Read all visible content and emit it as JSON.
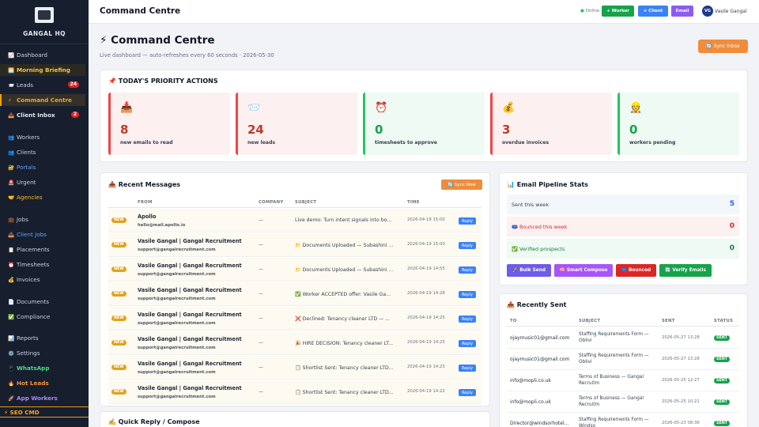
{
  "sidebar": {
    "brand": "GANGAL HQ",
    "items": [
      {
        "icon": "📈",
        "label": "Dashboard"
      },
      {
        "icon": "🌅",
        "label": "Morning Briefing"
      },
      {
        "icon": "📨",
        "label": "Leads",
        "badge": "24"
      },
      {
        "icon": "⚡",
        "label": "Command Centre"
      },
      {
        "icon": "📥",
        "label": "Client Inbox",
        "badge": "2"
      },
      {
        "icon": "👥",
        "label": "Workers"
      },
      {
        "icon": "👥",
        "label": "Clients"
      },
      {
        "icon": "🔐",
        "label": "Portals"
      },
      {
        "icon": "🚨",
        "label": "Urgent"
      },
      {
        "icon": "🤝",
        "label": "Agencies"
      },
      {
        "icon": "💼",
        "label": "Jobs"
      },
      {
        "icon": "📥",
        "label": "Client Jobs"
      },
      {
        "icon": "📋",
        "label": "Placements"
      },
      {
        "icon": "⏰",
        "label": "Timesheets"
      },
      {
        "icon": "💰",
        "label": "Invoices"
      },
      {
        "icon": "📄",
        "label": "Documents"
      },
      {
        "icon": "✅",
        "label": "Compliance"
      },
      {
        "icon": "📊",
        "label": "Reports"
      },
      {
        "icon": "⚙️",
        "label": "Settings"
      },
      {
        "icon": "📱",
        "label": "WhatsApp"
      },
      {
        "icon": "🔥",
        "label": "Hot Leads"
      },
      {
        "icon": "🚀",
        "label": "App Workers"
      }
    ],
    "seo": "⚡ SEO CMD"
  },
  "topbar": {
    "title": "Command Centre",
    "status": "Online",
    "buttons": [
      "+ Worker",
      "+ Client",
      "Email"
    ],
    "user_initials": "VG",
    "user_name": "Vasile Gangal"
  },
  "header": {
    "title": "⚡ Command Centre",
    "subtitle": "Live dashboard — auto-refreshes every 60 seconds · 2026-05-30",
    "sync_button": "🔄 Sync Inbox"
  },
  "priority": {
    "title": "📌 TODAY'S PRIORITY ACTIONS",
    "cards": [
      {
        "icon": "📥",
        "value": "8",
        "label": "new emails to read"
      },
      {
        "icon": "📨",
        "value": "24",
        "label": "new leads"
      },
      {
        "icon": "⏰",
        "value": "0",
        "label": "timesheets to approve"
      },
      {
        "icon": "💰",
        "value": "3",
        "label": "overdue invoices"
      },
      {
        "icon": "👷",
        "value": "0",
        "label": "workers pending"
      }
    ]
  },
  "messages": {
    "title": "📥 Recent Messages",
    "sync_button": "🔄 Sync Now",
    "columns": [
      "FROM",
      "COMPANY",
      "SUBJECT",
      "TIME"
    ],
    "badge": "NEW",
    "reply_label": "Reply",
    "rows": [
      {
        "name": "Apollo",
        "email": "hello@mail.apollo.io",
        "company": "—",
        "subject": "Live demo: Turn intent signals into bo...",
        "time": "2026-04-19 15:00"
      },
      {
        "name": "Vasile Gangal | Gangal Recruitment",
        "email": "support@gangalrecruitment.com",
        "company": "—",
        "subject": "📁 Documents Uploaded — Subashini ...",
        "time": "2026-04-19 15:00"
      },
      {
        "name": "Vasile Gangal | Gangal Recruitment",
        "email": "support@gangalrecruitment.com",
        "company": "—",
        "subject": "📁 Documents Uploaded — Subashini ...",
        "time": "2026-04-19 14:55"
      },
      {
        "name": "Vasile Gangal | Gangal Recruitment",
        "email": "support@gangalrecruitment.com",
        "company": "—",
        "subject": "✅ Worker ACCEPTED offer: Vasile Ga...",
        "time": "2026-04-19 14:28"
      },
      {
        "name": "Vasile Gangal | Gangal Recruitment",
        "email": "support@gangalrecruitment.com",
        "company": "—",
        "subject": "❌ Declined: Tenancy cleaner LTD — ...",
        "time": "2026-04-19 14:25"
      },
      {
        "name": "Vasile Gangal | Gangal Recruitment",
        "email": "support@gangalrecruitment.com",
        "company": "—",
        "subject": "🎉 HIRE DECISION: Tenancy cleaner LT...",
        "time": "2026-04-19 14:25"
      },
      {
        "name": "Vasile Gangal | Gangal Recruitment",
        "email": "support@gangalrecruitment.com",
        "company": "—",
        "subject": "📋 Shortlist Sent: Tenancy cleaner LTD...",
        "time": "2026-04-19 14:23"
      },
      {
        "name": "Vasile Gangal | Gangal Recruitment",
        "email": "support@gangalrecruitment.com",
        "company": "—",
        "subject": "📋 Shortlist Sent: Tenancy cleaner LTD...",
        "time": "2026-04-19 14:22"
      }
    ]
  },
  "quick_reply": {
    "title": "✍️ Quick Reply / Compose"
  },
  "pipeline": {
    "title": "📊 Email Pipeline Stats",
    "stats": [
      {
        "label": "Sent this week",
        "value": "5"
      },
      {
        "label": "📪 Bounced this week",
        "value": "0"
      },
      {
        "label": "✅ Verified prospects",
        "value": "0"
      }
    ],
    "buttons": [
      "🚀 Bulk Send",
      "🧠 Smart Compose",
      "📪 Bounced",
      "🔄 Verify Emails"
    ]
  },
  "recent_sent": {
    "title": "📤 Recently Sent",
    "columns": [
      "TO",
      "SUBJECT",
      "SENT",
      "STATUS"
    ],
    "badge": "SENT",
    "rows": [
      {
        "to": "ojaymusic01@gmail.com",
        "subject": "Staffing Requirements Form — Oblivi",
        "sent": "2026-05-27 13:28"
      },
      {
        "to": "ojaymusic01@gmail.com",
        "subject": "Staffing Requirements Form — Oblivi",
        "sent": "2026-05-27 13:28"
      },
      {
        "to": "info@mopli.co.uk",
        "subject": "Terms of Business — Gangal Recruitm",
        "sent": "2026-05-25 12:27"
      },
      {
        "to": "info@mopli.co.uk",
        "subject": "Terms of Business — Gangal Recruitm",
        "sent": "2026-05-25 10:21"
      },
      {
        "to": "Director@windsorhotel...",
        "subject": "Staffing Requirements Form — Windso",
        "sent": "2026-05-23 08:36"
      }
    ]
  },
  "colors": {
    "sidebar_bg": "#171e2e",
    "accent_orange": "#f08c3a",
    "danger": "#ef4444",
    "success": "#22c55e",
    "primary": "#3b82f6",
    "purple": "#8b5cf6"
  }
}
